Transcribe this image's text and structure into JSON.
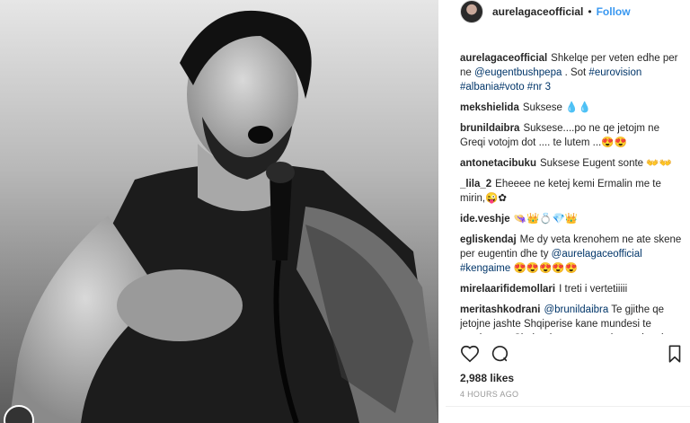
{
  "post": {
    "username": "aurelagaceofficial",
    "dot": "•",
    "follow_label": "Follow"
  },
  "comments": [
    {
      "user": "aurelagaceofficial",
      "text": "Shkelqe per veten edhe per ne ",
      "mention": "@eugentbushpepa",
      "tail": " . Sot ",
      "tags": "#eurovision #albania#voto #nr 3"
    },
    {
      "user": "mekshielida",
      "text": "Suksese 💧💧"
    },
    {
      "user": "brunildaibra",
      "text": "Suksese....po ne qe jetojm ne Greqi votojm dot .... te lutem ...😍😍"
    },
    {
      "user": "antonetacibuku",
      "text": "Suksese Eugent sonte 👐👐"
    },
    {
      "user": "_lila_2",
      "text": "Eheeee ne ketej kemi Ermalin me te mirin,😜✿"
    },
    {
      "user": "ide.veshje",
      "text": "👒👑💍💎👑"
    },
    {
      "user": "egliskendaj",
      "text": "Me dy veta krenohem ne ate skene per eugentin dhe ty ",
      "mention": "@aurelagaceofficial",
      "tail": " ",
      "tags": "#kengaime",
      "after": " 😍😍😍😍😍"
    },
    {
      "user": "mirelaarifidemollari",
      "text": "I treti i vertetiiiii"
    },
    {
      "user": "meritashkodrani",
      "text": "",
      "mention": "@brunildaibra",
      "tail": " Te gjithe qe jetojne jashte Shqiperise kane mundesi te votojne per Shqiperine ☺ mos u kurseni o njerez votoni votoni👉"
    }
  ],
  "actions": {
    "like_icon": "heart-icon",
    "comment_icon": "comment-icon",
    "bookmark_icon": "bookmark-icon"
  },
  "likes": "2,988 likes",
  "timestamp": "4 HOURS AGO"
}
